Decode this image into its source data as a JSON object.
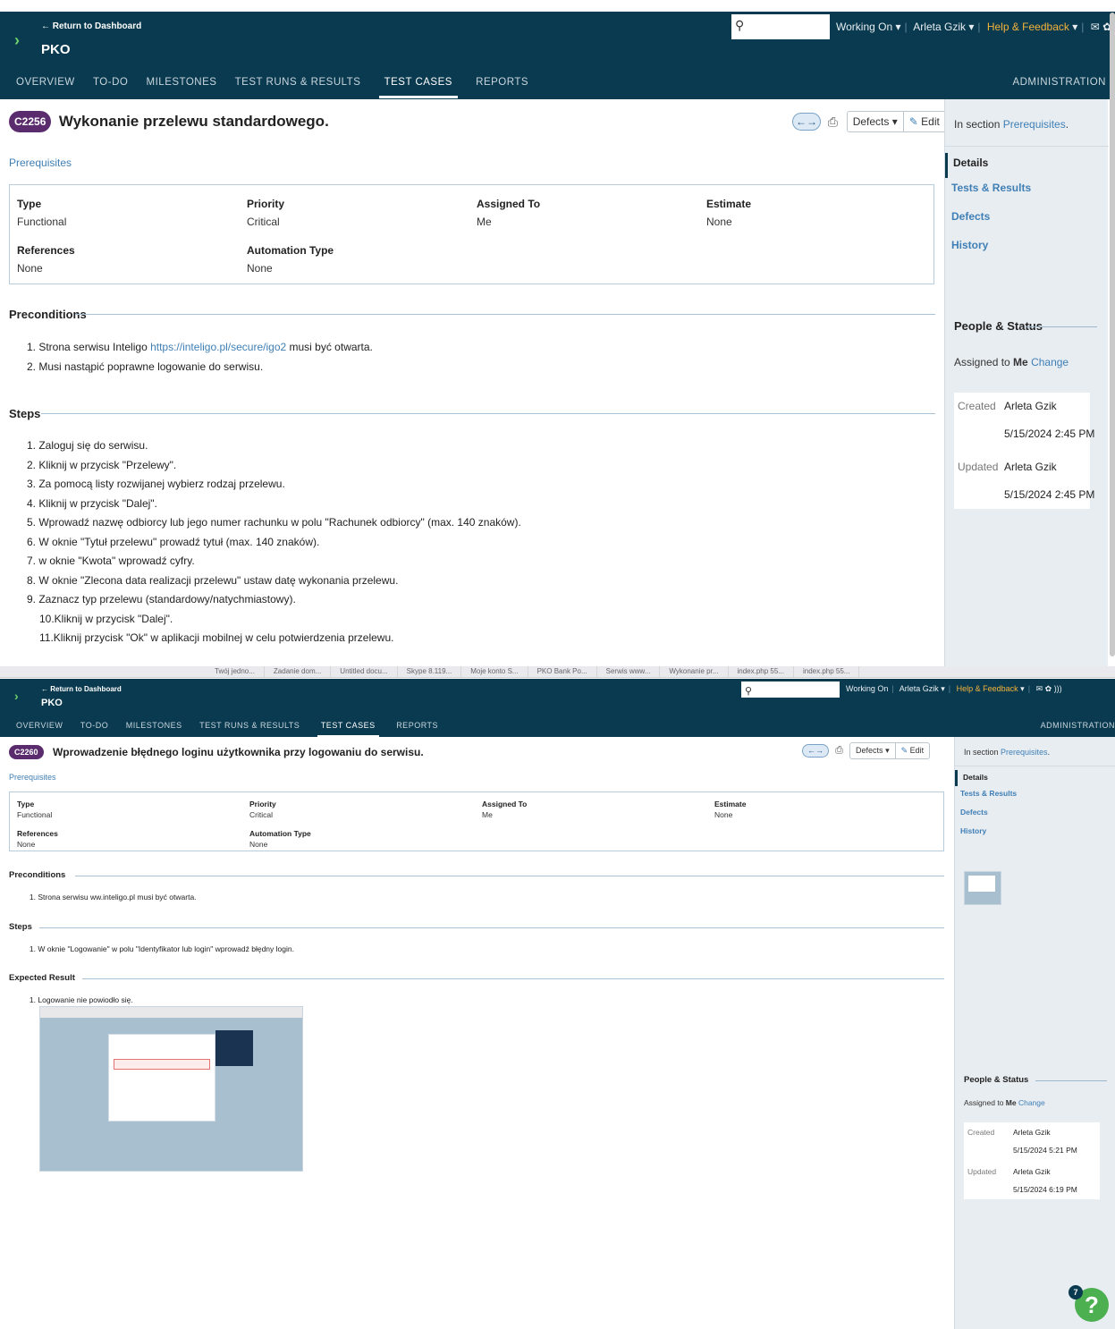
{
  "screens": [
    {
      "browser_tabs": [
        "Twój jedno...",
        "Zadanie dom...",
        "Untitled docu...",
        "Skype 8.119...",
        "Moje konto S...",
        "PKO Bank Po...",
        "Serwis www...",
        "Wykonanie pr...",
        "index.php 55...",
        "index.php 55..."
      ],
      "header": {
        "back_label": "← Return to Dashboard",
        "project": "PKO",
        "search_value": "",
        "working_on": "Working On",
        "user": "Arleta Gzik",
        "help": "Help & Feedback"
      },
      "nav": {
        "tabs": [
          "OVERVIEW",
          "TO-DO",
          "MILESTONES",
          "TEST RUNS & RESULTS",
          "TEST CASES",
          "REPORTS"
        ],
        "active": "TEST CASES",
        "admin": "ADMINISTRATION"
      },
      "case": {
        "id": "C2256",
        "title": "Wykonanie przelewu standardowego."
      },
      "toolbar": {
        "defects": "Defects",
        "edit": "Edit"
      },
      "section": "Prerequisites",
      "fields": [
        {
          "label": "Type",
          "value": "Functional"
        },
        {
          "label": "Priority",
          "value": "Critical"
        },
        {
          "label": "Assigned To",
          "value": "Me"
        },
        {
          "label": "Estimate",
          "value": "None"
        },
        {
          "label": "References",
          "value": "None"
        },
        {
          "label": "Automation Type",
          "value": "None"
        }
      ],
      "preconditions_title": "Preconditions",
      "preconditions": [
        {
          "num": "1.",
          "pre": "Strona serwisu Inteligo ",
          "link": "https://inteligo.pl/secure/igo2",
          "post": " musi być otwarta."
        },
        {
          "num": "2.",
          "pre": "Musi nastąpić poprawne logowanie do serwisu.",
          "link": "",
          "post": ""
        }
      ],
      "steps_title": "Steps",
      "steps": [
        {
          "num": "1.",
          "text": "Zaloguj się do serwisu."
        },
        {
          "num": "2.",
          "text": "Kliknij w przycisk \"Przelewy\"."
        },
        {
          "num": "3.",
          "text": "Za pomocą listy rozwijanej wybierz rodzaj przelewu."
        },
        {
          "num": "4.",
          "text": "Kliknij w przycisk \"Dalej\"."
        },
        {
          "num": "5.",
          "text": "Wprowadź nazwę odbiorcy lub jego numer rachunku w polu \"Rachunek odbiorcy\" (max. 140 znaków)."
        },
        {
          "num": "6.",
          "text": "W oknie \"Tytuł przelewu\" prowadź tytuł (max. 140 znaków)."
        },
        {
          "num": "7.",
          "text": "w oknie \"Kwota\" wprowadź cyfry."
        },
        {
          "num": "8.",
          "text": "W oknie \"Zlecona data realizacji przelewu\" ustaw datę wykonania przelewu."
        },
        {
          "num": "9.",
          "text": "Zaznacz typ przelewu (standardowy/natychmiastowy)."
        },
        {
          "num": "",
          "text": "10.Kliknij w przycisk \"Dalej\"."
        },
        {
          "num": "",
          "text": "11.Kliknij przycisk \"Ok\" w aplikacji mobilnej w celu potwierdzenia przelewu."
        }
      ],
      "sidebar": {
        "in_section": "In section ",
        "in_section_link": "Prerequisites",
        "in_section_end": ".",
        "nav": [
          "Details",
          "Tests & Results",
          "Defects",
          "History"
        ],
        "people_title": "People & Status",
        "assigned_pre": "Assigned to ",
        "assigned_me": "Me",
        "change": "Change",
        "created_label": "Created",
        "created_by": "Arleta Gzik",
        "created_at": "5/15/2024 2:45 PM",
        "updated_label": "Updated",
        "updated_by": "Arleta Gzik",
        "updated_at": "5/15/2024 2:45 PM"
      }
    },
    {
      "header": {
        "back_label": "← Return to Dashboard",
        "project": "PKO",
        "working_on": "Working On",
        "user": "Arleta Gzik",
        "help": "Help & Feedback"
      },
      "nav": {
        "tabs": [
          "OVERVIEW",
          "TO-DO",
          "MILESTONES",
          "TEST RUNS & RESULTS",
          "TEST CASES",
          "REPORTS"
        ],
        "admin": "ADMINISTRATION"
      },
      "case": {
        "id": "C2260",
        "title": "Wprowadzenie błędnego loginu użytkownika przy logowaniu do serwisu."
      },
      "toolbar": {
        "defects": "Defects",
        "edit": "Edit"
      },
      "section": "Prerequisites",
      "fields": [
        {
          "label": "Type",
          "value": "Functional"
        },
        {
          "label": "Priority",
          "value": "Critical"
        },
        {
          "label": "Assigned To",
          "value": "Me"
        },
        {
          "label": "Estimate",
          "value": "None"
        },
        {
          "label": "References",
          "value": "None"
        },
        {
          "label": "Automation Type",
          "value": "None"
        }
      ],
      "preconditions_title": "Preconditions",
      "preconditions": [
        {
          "num": "1.",
          "text": "Strona serwisu ww.inteligo.pl musi być otwarta."
        }
      ],
      "steps_title": "Steps",
      "steps": [
        {
          "num": "1.",
          "text": "W oknie \"Logowanie\" w polu \"Identyfikator lub login\" wprowadź błędny login."
        }
      ],
      "expected_title": "Expected Result",
      "expected": [
        {
          "num": "1.",
          "text": "Logowanie nie powiodło się."
        }
      ],
      "sidebar": {
        "in_section": "In section ",
        "in_section_link": "Prerequisites",
        "in_section_end": ".",
        "nav": [
          "Details",
          "Tests & Results",
          "Defects",
          "History"
        ],
        "people_title": "People & Status",
        "assigned_pre": "Assigned to ",
        "assigned_me": "Me",
        "change": "Change",
        "created_label": "Created",
        "created_by": "Arleta Gzik",
        "created_at": "5/15/2024 5:21 PM",
        "updated_label": "Updated",
        "updated_by": "Arleta Gzik",
        "updated_at": "5/15/2024 6:19 PM"
      },
      "help_count": "7",
      "help_icon": "?"
    }
  ]
}
